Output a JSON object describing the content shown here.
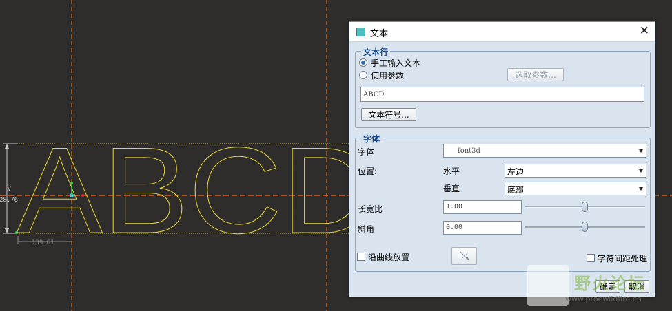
{
  "canvas": {
    "letters": "ABCD",
    "dim_height": "28.76",
    "dim_width": "139.61",
    "dim_v": "V"
  },
  "dialog": {
    "title": "文本",
    "close": "✕",
    "text_line": {
      "group_title": "文本行",
      "radio_manual": "手工输入文本",
      "radio_param": "使用参数",
      "select_param_button": "选取参数...",
      "text_value": "ABCD",
      "text_symbol_button": "文本符号..."
    },
    "font": {
      "group_title": "字体",
      "font_label": "字体",
      "font_value": "font3d",
      "position_label": "位置:",
      "horizontal_label": "水平",
      "horizontal_value": "左边",
      "vertical_label": "垂直",
      "vertical_value": "底部",
      "aspect_label": "长宽比",
      "aspect_value": "1.00",
      "slant_label": "斜角",
      "slant_value": "0.00",
      "along_curve_label": "沿曲线放置",
      "kerning_label": "字符间距处理"
    },
    "ok_button": "确定",
    "cancel_button": "取消"
  },
  "watermark": {
    "text": "野火论坛",
    "url": "www.proewildfire.cn"
  },
  "colors": {
    "background": "#2f2d2b",
    "letter_outline": "#e6d534",
    "guide_line": "#ff6b1a",
    "dimension": "#c8c8c8",
    "dialog_bg": "#d9e4ee"
  }
}
